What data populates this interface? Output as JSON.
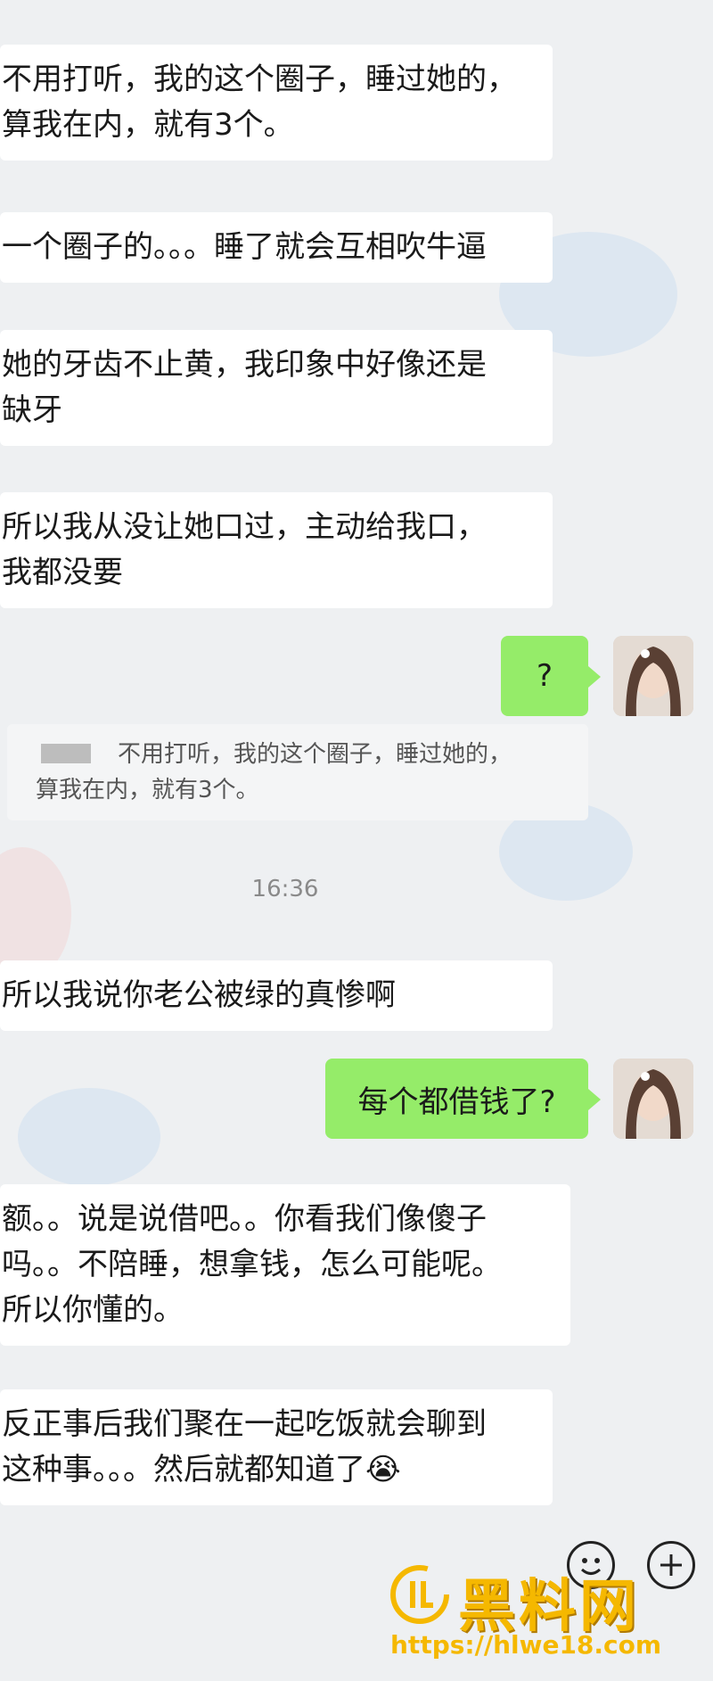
{
  "messages": [
    {
      "lines": [
        "不用打听，我的这个圈子，睡过她的，",
        "算我在内，就有3个。"
      ]
    },
    {
      "lines": [
        "一个圈子的。。。睡了就会互相吹牛逼"
      ]
    },
    {
      "lines": [
        "她的牙齿不止黄，我印象中好像还是",
        "缺牙"
      ]
    },
    {
      "lines": [
        "所以我从没让她口过，主动给我口，",
        "我都没要"
      ]
    },
    {
      "lines": [
        "所以我说你老公被绿的真惨啊"
      ]
    },
    {
      "lines": [
        "额。。说是说借吧。。你看我们像傻子",
        "吗。。不陪睡，想拿钱，怎么可能呢。",
        "所以你懂的。"
      ]
    },
    {
      "lines": [
        "反正事后我们聚在一起吃饭就会聊到",
        "这种事。。。然后就都知道了😭"
      ]
    }
  ],
  "outgoing": [
    {
      "text": "?"
    },
    {
      "text": "每个都借钱了?"
    }
  ],
  "quote": {
    "lines": [
      "不用打听，我的这个圈子，睡过她的，",
      "算我在内，就有3个。"
    ]
  },
  "timestamp": "16:36",
  "watermark": {
    "logo_text": "黑料网",
    "url": "https://hlwe18.com",
    "accent": "#f5b800"
  },
  "icons": [
    "emoji-icon",
    "add-icon",
    "avatar"
  ]
}
